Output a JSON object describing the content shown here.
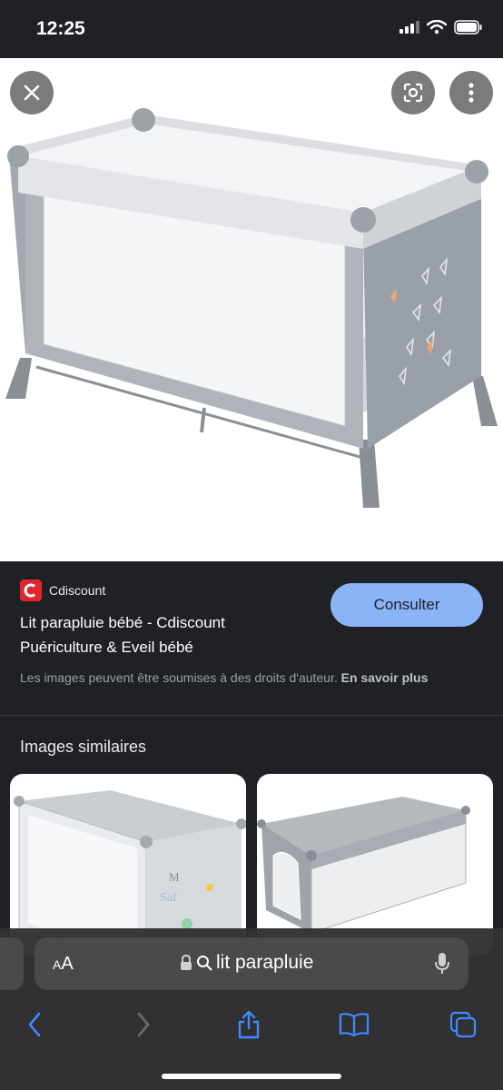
{
  "status": {
    "time": "12:25"
  },
  "image_viewer": {
    "close_icon": "close-icon",
    "lens_icon": "lens-icon",
    "more_icon": "more-vert-icon"
  },
  "result": {
    "source_name": "Cdiscount",
    "title": "Lit parapluie bébé - Cdiscount Puériculture & Eveil bébé",
    "consult_label": "Consulter",
    "copyright_text": "Les images peuvent être soumises à des droits d'auteur.",
    "learn_more": "En savoir plus",
    "accent": "#8ab4f8"
  },
  "similar": {
    "title": "Images similaires"
  },
  "browser": {
    "aa_small": "A",
    "aa_big": "A",
    "url_text": "lit parapluie"
  }
}
